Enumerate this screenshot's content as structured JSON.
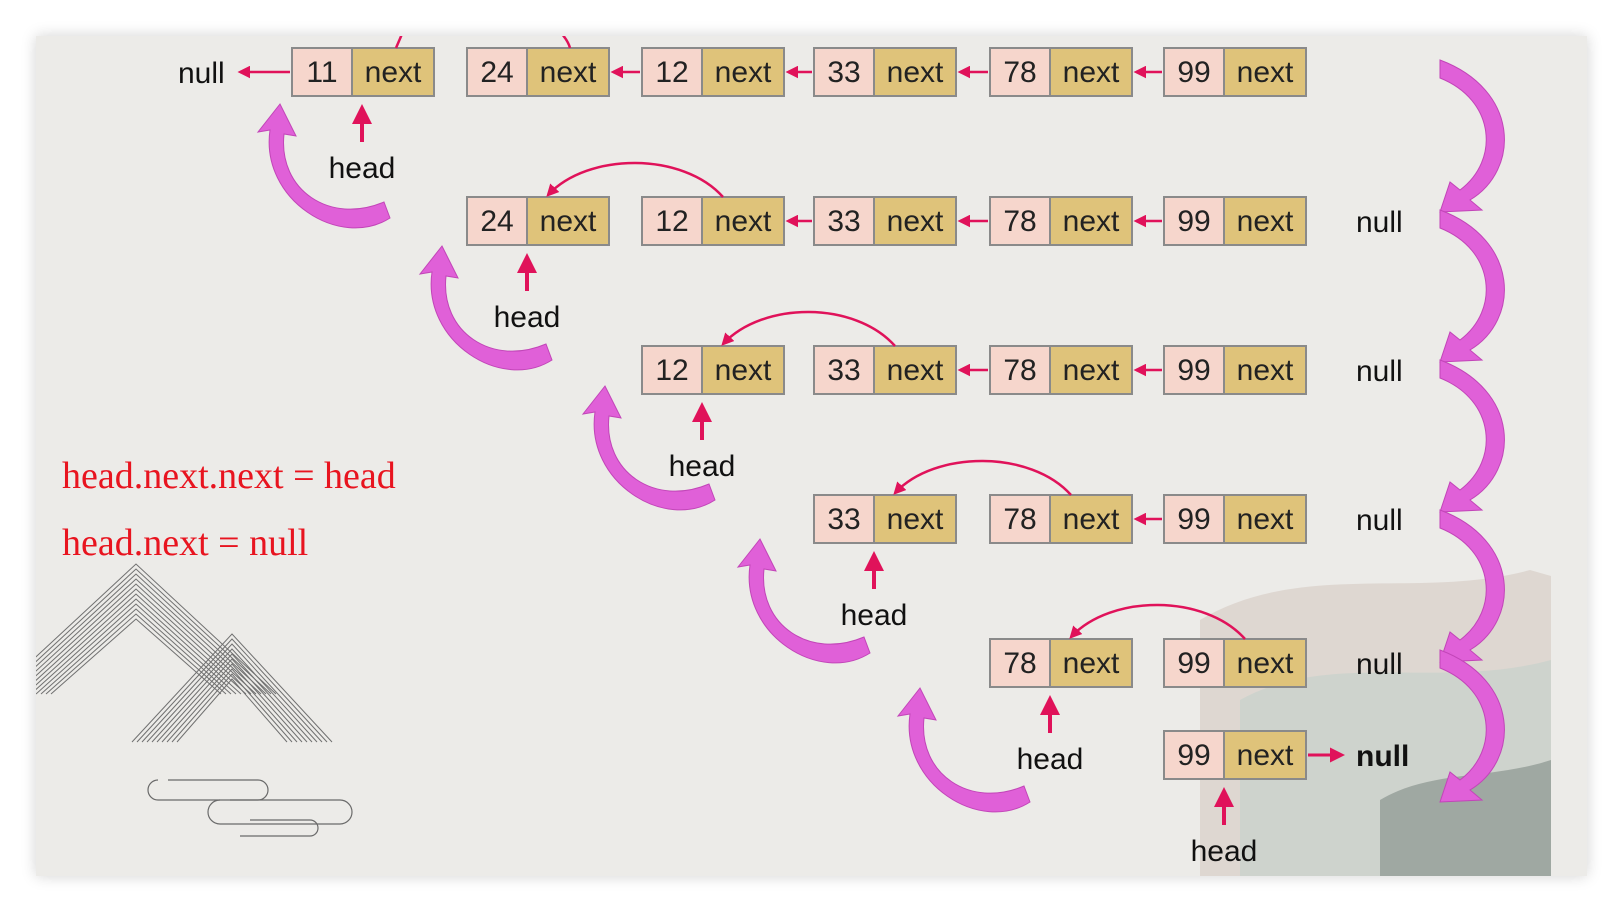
{
  "colors": {
    "value_box": "#f6d6cc",
    "next_box": "#dfc37a",
    "box_border": "#8a8a8a",
    "pointer_arrow": "#e0125a",
    "curve_arrow": "#e060d8",
    "code": "#e8141f"
  },
  "code_lines": [
    "head.next.next = head",
    "head.next = null"
  ],
  "next_label": "next",
  "null_label": "null",
  "head_label": "head",
  "rows": [
    {
      "nodes": [
        "11",
        "24",
        "12",
        "33",
        "78",
        "99"
      ],
      "null_left": "null"
    },
    {
      "nodes": [
        "24",
        "12",
        "33",
        "78",
        "99"
      ],
      "null_right": "null"
    },
    {
      "nodes": [
        "12",
        "33",
        "78",
        "99"
      ],
      "null_right": "null"
    },
    {
      "nodes": [
        "33",
        "78",
        "99"
      ],
      "null_right": "null"
    },
    {
      "nodes": [
        "78",
        "99"
      ],
      "null_right": "null"
    },
    {
      "nodes": [
        "99"
      ],
      "null_right": "null"
    }
  ]
}
